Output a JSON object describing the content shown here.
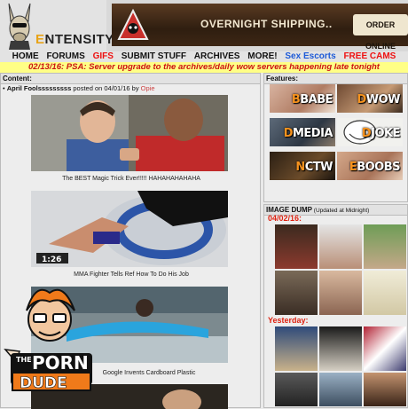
{
  "site": {
    "name_first": "E",
    "name_rest": "NTENSITY"
  },
  "banner": {
    "text": "OVERNIGHT SHIPPING..",
    "button": "ORDER ONLINE"
  },
  "nav": [
    {
      "label": "HOME",
      "color": "default"
    },
    {
      "label": "FORUMS",
      "color": "default"
    },
    {
      "label": "GIFS",
      "color": "red"
    },
    {
      "label": "SUBMIT STUFF",
      "color": "default"
    },
    {
      "label": "ARCHIVES",
      "color": "default"
    },
    {
      "label": "MORE!",
      "color": "default"
    },
    {
      "label": "Sex Escorts",
      "color": "blue"
    },
    {
      "label": "FREE CAMS",
      "color": "red"
    }
  ],
  "psa": "02/13/16: PSA: Server upgrade to the archives/daily wow servers happening late tonight",
  "content": {
    "title": "Content:",
    "post": {
      "title": "April Foolsssssssss",
      "posted_on": " posted on 04/01/16 by ",
      "author": "Opie"
    },
    "captions": [
      "The BEST Magic Trick Ever!!!!! HAHAHAHAHAHA",
      "MMA Fighter Tells Ref How To Do His Job",
      "Google Invents Cardboard Plastic"
    ],
    "scoreboard": "1:26"
  },
  "features": {
    "title": "Features:",
    "items": [
      {
        "first": "B",
        "rest": "BABE"
      },
      {
        "first": "D",
        "rest": "WOW"
      },
      {
        "first": "D",
        "rest": "MEDIA"
      },
      {
        "first": "D",
        "rest": "JOKE"
      },
      {
        "first": "N",
        "rest": "CTW"
      },
      {
        "first": "E",
        "rest": "BOOBS"
      }
    ]
  },
  "image_dump": {
    "title": "IMAGE DUMP",
    "updated": " (Updated at Midnight)",
    "today": "04/02/16:",
    "yesterday": "Yesterday:"
  },
  "badge": {
    "the": "THE",
    "porn": "PORN",
    "dude": "DUDE"
  },
  "colors": {
    "accent_orange": "#f7931e",
    "nav_red": "#e11111",
    "nav_blue": "#1e5bd8",
    "psa_bg": "#ffff86"
  }
}
